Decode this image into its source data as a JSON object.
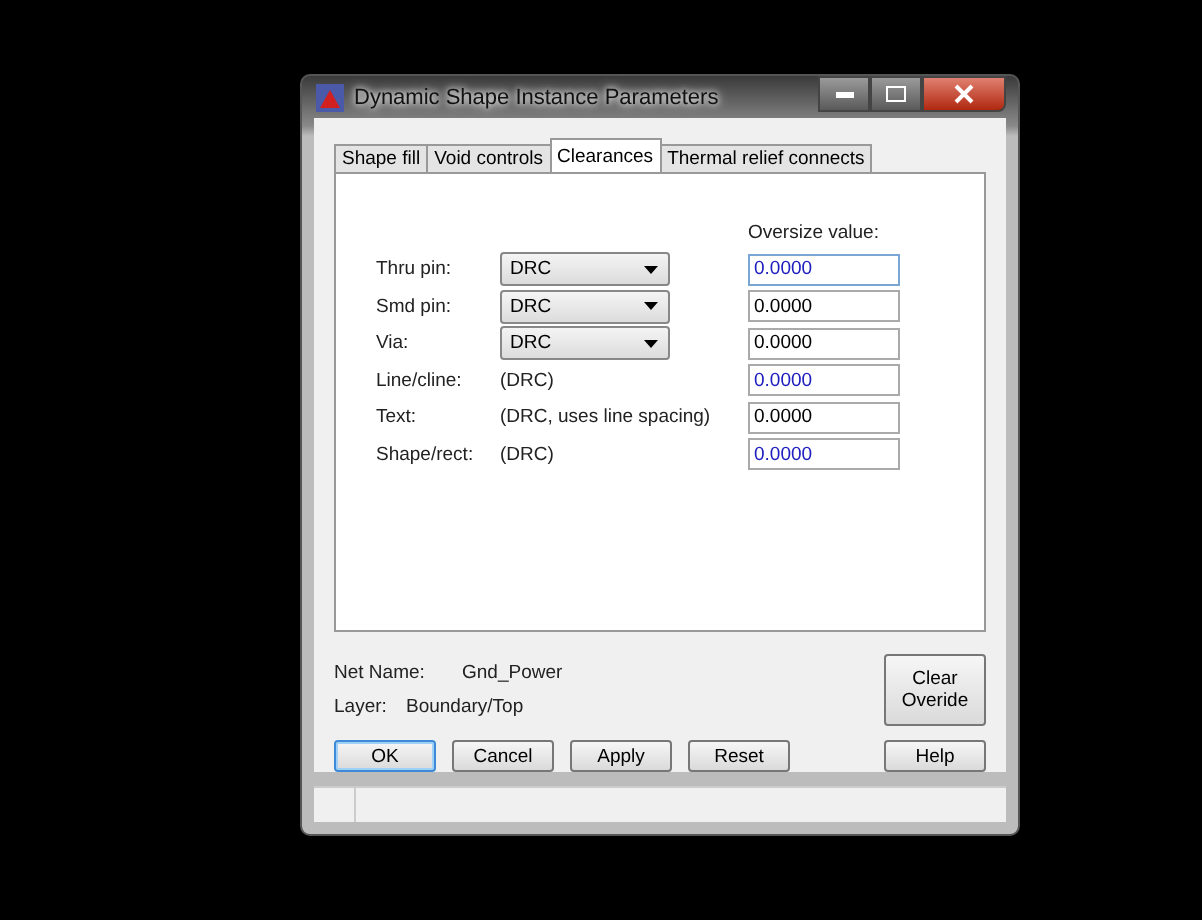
{
  "window": {
    "title": "Dynamic Shape Instance Parameters"
  },
  "tabs": [
    {
      "label": "Shape fill",
      "selected": false
    },
    {
      "label": "Void controls",
      "selected": false
    },
    {
      "label": "Clearances",
      "selected": true
    },
    {
      "label": "Thermal relief connects",
      "selected": false
    }
  ],
  "oversize_header": "Oversize value:",
  "rows": [
    {
      "label": "Thru pin:",
      "kind": "combo",
      "setting": "DRC",
      "value": "0.0000",
      "color": "#2020c0",
      "focused": true
    },
    {
      "label": "Smd pin:",
      "kind": "combo",
      "setting": "DRC",
      "value": "0.0000",
      "color": "#000000",
      "focused": false
    },
    {
      "label": "Via:",
      "kind": "combo",
      "setting": "DRC",
      "value": "0.0000",
      "color": "#000000",
      "focused": false
    },
    {
      "label": "Line/cline:",
      "kind": "text",
      "setting": "(DRC)",
      "value": "0.0000",
      "color": "#2020c0",
      "focused": false
    },
    {
      "label": "Text:",
      "kind": "text",
      "setting": "(DRC, uses line spacing)",
      "value": "0.0000",
      "color": "#000000",
      "focused": false
    },
    {
      "label": "Shape/rect:",
      "kind": "text",
      "setting": "(DRC)",
      "value": "0.0000",
      "color": "#2020c0",
      "focused": false
    }
  ],
  "net_name": {
    "label": "Net Name:",
    "value": "Gnd_Power"
  },
  "layer": {
    "label": "Layer:",
    "value": "Boundary/Top"
  },
  "clear_button": "Clear Overide",
  "buttons": [
    {
      "label": "OK",
      "default": true
    },
    {
      "label": "Cancel",
      "default": false
    },
    {
      "label": "Apply",
      "default": false
    },
    {
      "label": "Reset",
      "default": false
    }
  ],
  "help_button": "Help"
}
